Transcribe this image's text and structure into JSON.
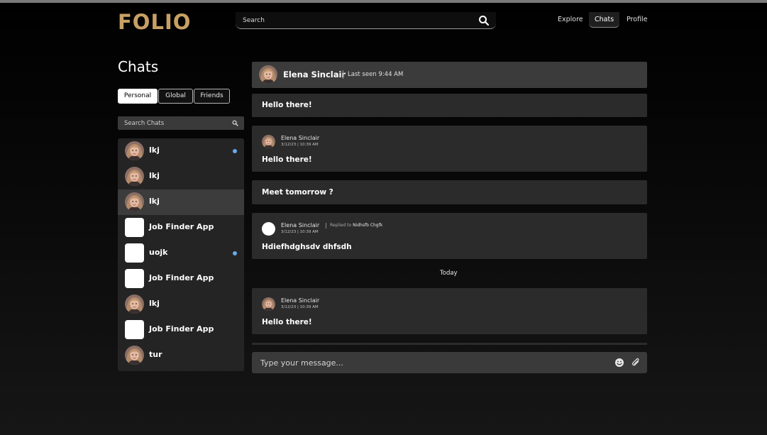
{
  "header": {
    "logo": "FOLIO",
    "search_placeholder": "Search",
    "nav": [
      "Explore",
      "Chats",
      "Profile"
    ],
    "active_nav": "Chats"
  },
  "sidebar": {
    "title": "Chats",
    "tabs": [
      "Personal",
      "Global",
      "Friends"
    ],
    "active_tab": "Personal",
    "search_placeholder": "Search Chats",
    "chats": [
      {
        "name": "lkj",
        "avatar": "photo",
        "unread": true
      },
      {
        "name": "lkj",
        "avatar": "photo",
        "unread": false
      },
      {
        "name": "lkj",
        "avatar": "photo",
        "unread": false,
        "selected": true
      },
      {
        "name": "Job Finder App",
        "avatar": "blank",
        "unread": false
      },
      {
        "name": "uojk",
        "avatar": "blank",
        "unread": true
      },
      {
        "name": "Job Finder App",
        "avatar": "blank",
        "unread": false
      },
      {
        "name": "lkj",
        "avatar": "photo",
        "unread": false
      },
      {
        "name": "Job Finder App",
        "avatar": "blank",
        "unread": false
      },
      {
        "name": "tur",
        "avatar": "photo",
        "unread": false
      }
    ]
  },
  "conversation": {
    "contact_name": "Elena Sinclair",
    "last_seen": "Last seen 9:44 AM",
    "messages": [
      {
        "text": "Hello there!"
      },
      {
        "sender": "Elena Sinclair",
        "time": "3/12/23 | 10:39 AM",
        "text": "Hello there!"
      },
      {
        "text": "Meet tomorrow ?"
      },
      {
        "sender": "Elena Sinclair",
        "reply_prefix": "Replied to",
        "reply_to": "Nidhsfb Chgfk",
        "time": "3/12/23 | 10:39 AM",
        "text": "Hdiefhdghsdv dhfsdh"
      },
      {
        "sender": "Elena Sinclair",
        "time": "3/12/23 | 10:39 AM",
        "text": "Hello there!"
      }
    ],
    "day_divider": "Today",
    "composer_placeholder": "Type your message..."
  },
  "colors": {
    "accent": "#c8a064",
    "unread_dot": "#6aa9ec",
    "panel": "#2b2b2b",
    "header_panel": "#3b3b3b"
  },
  "icons": [
    "search-icon",
    "emoji-icon",
    "paperclip-icon"
  ]
}
